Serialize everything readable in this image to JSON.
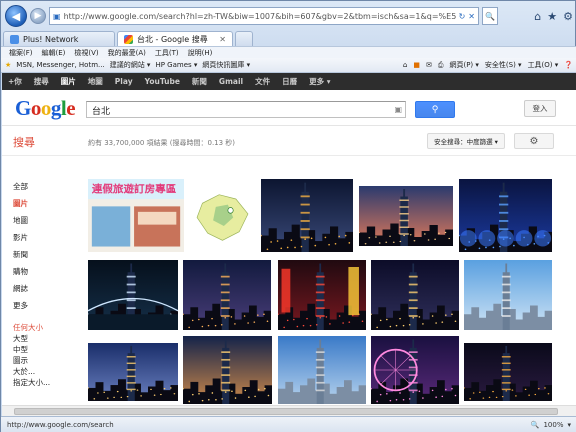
{
  "browser": {
    "url": "http://www.google.com/search?hl=zh-TW&biw=1007&bih=607&gbv=2&tbm=isch&sa=1&q=%E5%8F%B0%E5%8C%97&oq=%E5%",
    "tabs": [
      {
        "label": "Plus! Network",
        "active": false
      },
      {
        "label": "台北 - Google 搜尋",
        "active": true
      }
    ],
    "menu": [
      "檔案(F)",
      "編輯(E)",
      "檢視(V)",
      "我的最愛(A)",
      "工具(T)",
      "說明(H)"
    ],
    "favorites": [
      "MSN, Messenger, Hotm...",
      "建議的網站 ▾",
      "HP Games ▾",
      "網頁快訊圖庫 ▾"
    ],
    "commands": [
      "網頁(P) ▾",
      "安全性(S) ▾",
      "工具(O) ▾"
    ],
    "status_url": "http://www.google.com/search",
    "zoom": "100%"
  },
  "gbar": [
    "+你",
    "搜尋",
    "圖片",
    "地圖",
    "Play",
    "YouTube",
    "新聞",
    "Gmail",
    "文件",
    "日曆",
    "更多 ▾"
  ],
  "gbar_active": "圖片",
  "logo": "Google",
  "search": {
    "query": "台北"
  },
  "login_label": "登入",
  "sou_label": "搜尋",
  "stats": "約有 33,700,000 項結果 (搜尋時間：0.13 秒)",
  "safe_search": "安全搜尋：中度篩選 ▾",
  "sidebar": {
    "types": [
      "全部",
      "圖片",
      "地圖",
      "影片",
      "新聞",
      "購物",
      "網誌",
      "更多"
    ],
    "selected": "圖片",
    "size_title": "任何大小",
    "sizes": [
      "大型",
      "中型",
      "圖示",
      "大於...",
      "指定大小..."
    ]
  },
  "banner_text": "連假旅遊訂房專區",
  "colors": {
    "red": "#dd4b39",
    "blue": "#4787ed"
  }
}
